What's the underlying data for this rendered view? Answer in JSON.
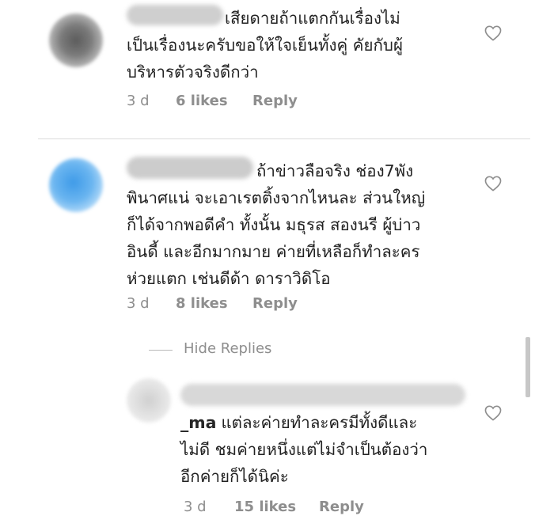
{
  "comments": [
    {
      "text": "เสียดายถ้าแตกกันเรื่องไม่\nเป็นเรื่องนะครับขอให้ใจเย็นทั้งคู่ คัยกับผู้\nบริหารตัวจริงดีกว่า",
      "time": "3 d",
      "likes": "6 likes",
      "reply": "Reply"
    },
    {
      "text": "ถ้าข่าวลือจริง ช่อง7พัง\nพินาศแน่ จะเอาเรตติ้งจากไหนละ ส่วนใหญ่\nก็ได้จากพอดีคำ ทั้งนั้น มธุรส สองนรี ผู้บ่าว\nอินดี้ และอีกมากมาย ค่ายที่เหลือก็ทำละคร\nห่วยแตก เช่นดีด้า ดาราวิดิโอ",
      "time": "3 d",
      "likes": "8 likes",
      "reply": "Reply",
      "hide_replies": "Hide Replies"
    },
    {
      "username": "_ma",
      "text": "แต่ละค่ายทำละครมีทั้งดีและ\nไม่ดี ชมค่ายหนึ่งแต่ไม่จำเป็นต้องว่า\nอีกค่ายก็ได้นิค่ะ",
      "time": "3 d",
      "likes": "15 likes",
      "reply": "Reply"
    }
  ],
  "icons": {
    "like": "heart-outline-icon"
  },
  "colors": {
    "text": "#262626",
    "meta": "#8e8e8e",
    "divider": "#dbdbdb"
  }
}
